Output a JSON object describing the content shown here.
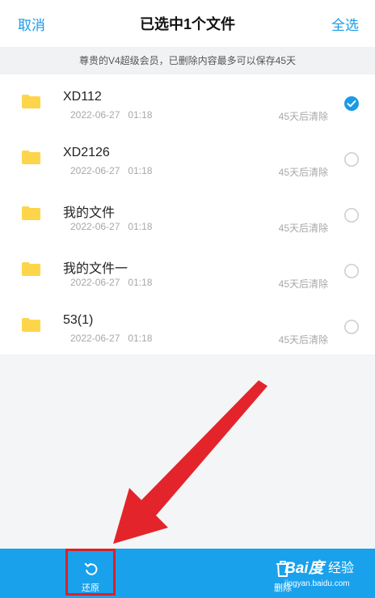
{
  "header": {
    "cancel_label": "取消",
    "title": "已选中1个文件",
    "select_all_label": "全选"
  },
  "notice": "尊贵的V4超级会员，已删除内容最多可以保存45天",
  "files": [
    {
      "name": "XD112",
      "date": "2022-06-27",
      "time": "01:18",
      "expire": "45天后清除",
      "selected": true
    },
    {
      "name": "XD2126",
      "date": "2022-06-27",
      "time": "01:18",
      "expire": "45天后清除",
      "selected": false
    },
    {
      "name": "我的文件",
      "date": "2022-06-27",
      "time": "01:18",
      "expire": "45天后清除",
      "selected": false
    },
    {
      "name": "我的文件一",
      "date": "2022-06-27",
      "time": "01:18",
      "expire": "45天后清除",
      "selected": false
    },
    {
      "name": "53(1)",
      "date": "2022-06-27",
      "time": "01:18",
      "expire": "45天后清除",
      "selected": false
    }
  ],
  "bottom_bar": {
    "restore_label": "还原",
    "restore_icon": "restore-icon",
    "delete_label": "删除",
    "delete_icon": "trash-icon"
  },
  "watermark": {
    "logo": "Bai度",
    "text": "经验",
    "url": "jingyan.baidu.com"
  },
  "colors": {
    "accent": "#1a9be8",
    "bottom_bar": "#1aa1ec",
    "folder": "#fdd54a",
    "highlight": "#d9212a"
  }
}
